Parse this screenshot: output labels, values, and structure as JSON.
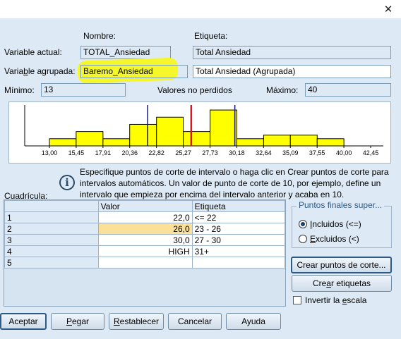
{
  "window": {
    "close_glyph": "✕"
  },
  "header": {
    "name_col": "Nombre:",
    "label_col": "Etiqueta:"
  },
  "current_var": {
    "label": "Variable actual:",
    "name": "TOTAL_Ansiedad",
    "etiqueta": "Total Ansiedad"
  },
  "grouped_var": {
    "label_a": "Varia",
    "label_u": "b",
    "label_b": "le agrupada:",
    "name": "Baremo_Ansiedad",
    "etiqueta": "Total Ansiedad (Agrupada)"
  },
  "stats": {
    "min_label": "Mínimo:",
    "min_value": "13",
    "valid_label": "Valores no perdidos",
    "max_label": "Máximo:",
    "max_value": "40"
  },
  "chart_data": {
    "type": "bar",
    "x_ticks": [
      "13,00",
      "15,45",
      "17,91",
      "20,36",
      "22,82",
      "25,27",
      "27,73",
      "30,18",
      "32,64",
      "35,09",
      "37,55",
      "40,00",
      "42,45"
    ],
    "bins": [
      {
        "from": 13.0,
        "to": 15.45,
        "count": 1
      },
      {
        "from": 15.45,
        "to": 17.91,
        "count": 2
      },
      {
        "from": 17.91,
        "to": 20.36,
        "count": 1
      },
      {
        "from": 20.36,
        "to": 22.82,
        "count": 3
      },
      {
        "from": 22.82,
        "to": 25.27,
        "count": 4
      },
      {
        "from": 25.27,
        "to": 27.73,
        "count": 2
      },
      {
        "from": 27.73,
        "to": 30.18,
        "count": 5
      },
      {
        "from": 30.18,
        "to": 32.64,
        "count": 1
      },
      {
        "from": 32.64,
        "to": 35.09,
        "count": 1.5
      },
      {
        "from": 35.09,
        "to": 37.55,
        "count": 1.5
      },
      {
        "from": 37.55,
        "to": 40.0,
        "count": 1
      },
      {
        "from": 40.0,
        "to": 42.45,
        "count": 0
      }
    ],
    "xlim": [
      13.0,
      42.45
    ],
    "ylim": [
      0,
      5.5
    ],
    "cut_lines": [
      {
        "x": 22.0,
        "color": "#1a1a8c"
      },
      {
        "x": 26.0,
        "color": "#e0141e"
      },
      {
        "x": 30.0,
        "color": "#1a1a8c"
      }
    ],
    "bar_color": "#ffff00"
  },
  "info": {
    "icon": "info-icon",
    "text": "Especifique puntos de corte de intervalo o haga clic en Crear puntos de corte para intervalos automáticos. Un valor de punto de corte de 10, por ejemplo, define un intervalo que empieza por encima del intervalo anterior y acaba en 10."
  },
  "grid": {
    "label": "Cuadrícula:",
    "columns": [
      "Valor",
      "Etiqueta"
    ],
    "rows": [
      {
        "num": "1",
        "valor": "22,0",
        "etiqueta": "<= 22"
      },
      {
        "num": "2",
        "valor": "26,0",
        "etiqueta": "23 - 26"
      },
      {
        "num": "3",
        "valor": "30,0",
        "etiqueta": "27 - 30"
      },
      {
        "num": "4",
        "valor": "HIGH",
        "etiqueta": "31+"
      },
      {
        "num": "5",
        "valor": "",
        "etiqueta": ""
      }
    ]
  },
  "endpoints": {
    "title": "Puntos finales super...",
    "included_a": "",
    "included_u": "I",
    "included_b": "ncluidos (<=)",
    "excluded_a": "",
    "excluded_u": "E",
    "excluded_b": "xcluidos (<)"
  },
  "side_buttons": {
    "make_cutpoints": "Crear puntos de corte...",
    "make_labels_a": "Cre",
    "make_labels_u": "a",
    "make_labels_b": "r etiquetas",
    "reverse_a": "Invertir la ",
    "reverse_u": "e",
    "reverse_b": "scala"
  },
  "footer": {
    "ok": "Aceptar",
    "paste_u": "P",
    "paste_b": "egar",
    "reset_u": "R",
    "reset_b": "establecer",
    "cancel": "Cancelar",
    "help": "Ayuda"
  }
}
